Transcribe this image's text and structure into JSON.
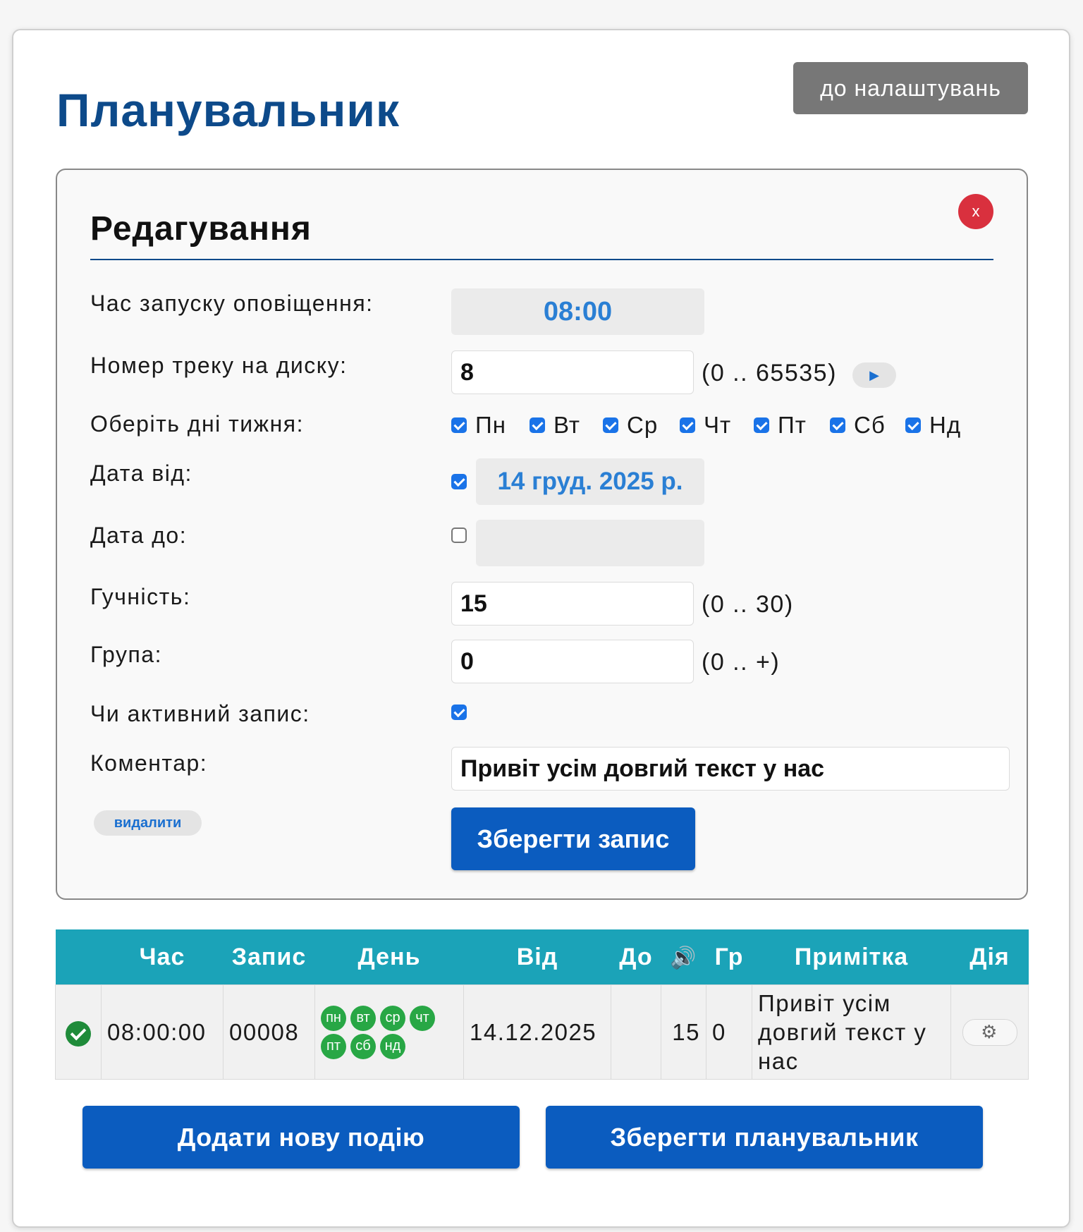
{
  "page": {
    "title": "Планувальник",
    "settings_button": "до налаштувань"
  },
  "editor": {
    "title": "Редагування",
    "close_label": "x",
    "fields": {
      "time": {
        "label": "Час запуску оповіщення:",
        "value": "08:00"
      },
      "track": {
        "label": "Номер треку на диску:",
        "value": "8",
        "range": "(0 .. 65535)",
        "play_icon": "play-icon"
      },
      "days": {
        "label": "Оберіть дні тижня:",
        "items": [
          {
            "label": "Пн",
            "checked": true
          },
          {
            "label": "Вт",
            "checked": true
          },
          {
            "label": "Ср",
            "checked": true
          },
          {
            "label": "Чт",
            "checked": true
          },
          {
            "label": "Пт",
            "checked": true
          },
          {
            "label": "Сб",
            "checked": true
          },
          {
            "label": "Нд",
            "checked": true
          }
        ]
      },
      "date_from": {
        "label": "Дата від:",
        "checked": true,
        "value": "14 груд. 2025 р."
      },
      "date_to": {
        "label": "Дата до:",
        "checked": false,
        "value": ""
      },
      "volume": {
        "label": "Гучність:",
        "value": "15",
        "range": "(0 .. 30)"
      },
      "group": {
        "label": "Група:",
        "value": "0",
        "range": "(0 .. +)"
      },
      "active": {
        "label": "Чи активний запис:",
        "checked": true
      },
      "comment": {
        "label": "Коментар:",
        "value": "Привіт усім довгий текст у нас"
      }
    },
    "delete_button": "видалити",
    "save_record_button": "Зберегти запис"
  },
  "table": {
    "headers": [
      "",
      "Час",
      "Запис",
      "День",
      "Від",
      "До",
      "speaker-icon",
      "Гр",
      "Примітка",
      "Дія"
    ],
    "rows": [
      {
        "status_icon": "check-circle-icon",
        "time": "08:00:00",
        "record": "00008",
        "days": [
          "пн",
          "вт",
          "ср",
          "чт",
          "пт",
          "сб",
          "нд"
        ],
        "from": "14.12.2025",
        "to": "",
        "volume": "15",
        "group": "0",
        "note": "Привіт усім довгий текст у нас",
        "action_icon": "gear-icon"
      }
    ]
  },
  "footer": {
    "add_event_button": "Додати нову подію",
    "save_scheduler_button": "Зберегти планувальник"
  },
  "colors": {
    "title": "#0d4a8a",
    "primary_button": "#0b5cbf",
    "table_header": "#1ba3b8",
    "day_badge": "#28a745",
    "close": "#d9303e",
    "settings_button": "#777777"
  }
}
